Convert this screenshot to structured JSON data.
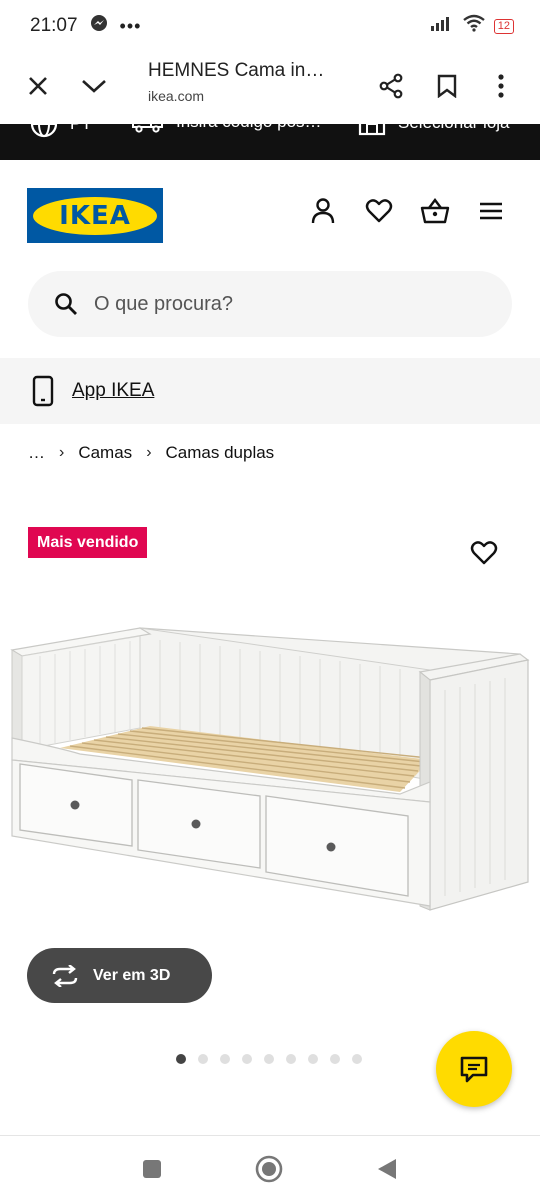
{
  "status_bar": {
    "time": "21:07",
    "battery": "12"
  },
  "browser": {
    "title": "HEMNES Cama in…",
    "url": "ikea.com"
  },
  "info_bar": {
    "country": "PT",
    "postcode": "Insira código pos…",
    "store": "Selecionar loja"
  },
  "logo": {
    "text": "IKEA"
  },
  "search": {
    "placeholder": "O que procura?"
  },
  "app_banner": {
    "label": "App IKEA"
  },
  "breadcrumb": [
    "…",
    "Camas",
    "Camas duplas"
  ],
  "product": {
    "badge": "Mais vendido",
    "view_3d_label": "Ver em 3D",
    "image_count": 9,
    "active_image_index": 0
  },
  "colors": {
    "ikea_blue": "#0058a3",
    "ikea_yellow": "#ffdb00",
    "badge_red": "#e00751"
  }
}
